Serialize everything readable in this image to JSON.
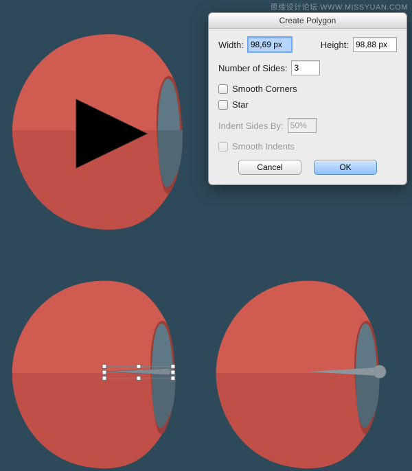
{
  "watermark": "思缘设计论坛  WWW.MISSYUAN.COM",
  "dialog": {
    "title": "Create Polygon",
    "width_label": "Width:",
    "width_value": "98,69 px",
    "height_label": "Height:",
    "height_value": "98,88 px",
    "sides_label": "Number of Sides:",
    "sides_value": "3",
    "smooth_corners_label": "Smooth Corners",
    "star_label": "Star",
    "indent_label": "Indent Sides By:",
    "indent_value": "50%",
    "smooth_indents_label": "Smooth Indents",
    "cancel_label": "Cancel",
    "ok_label": "OK",
    "smooth_corners_checked": false,
    "star_checked": false,
    "smooth_indents_checked": false
  },
  "canvas": {
    "background": "#2e4a5a",
    "shape_colors": {
      "top_light": "#cf5b51",
      "top_shadow": "#c04f47",
      "inner_rim": "#9c3e38",
      "inner_face_top": "#5f7885",
      "inner_face_bottom": "#516773",
      "triangle": "#000000",
      "needle": "#7e8a92",
      "needle_tip": "#8a959c"
    }
  },
  "chart_data": {
    "type": "table",
    "title": "Create Polygon dialog values",
    "rows": [
      {
        "field": "Width",
        "value": "98,69 px"
      },
      {
        "field": "Height",
        "value": "98,88 px"
      },
      {
        "field": "Number of Sides",
        "value": 3
      },
      {
        "field": "Smooth Corners",
        "value": false
      },
      {
        "field": "Star",
        "value": false
      },
      {
        "field": "Indent Sides By",
        "value": "50%"
      },
      {
        "field": "Smooth Indents",
        "value": false
      }
    ]
  }
}
